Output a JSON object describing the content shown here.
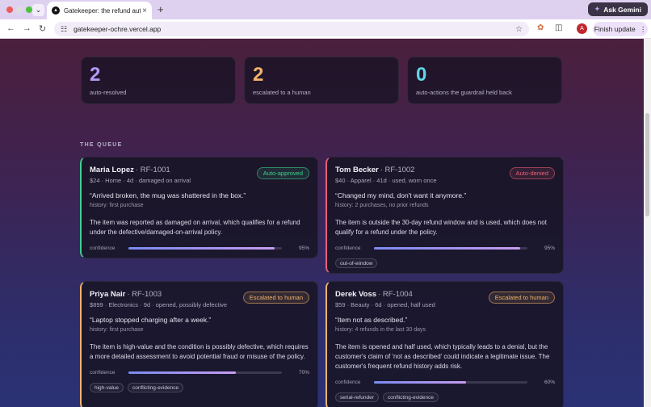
{
  "browser": {
    "tab_title": "Gatekeeper: the refund autopilot",
    "url": "gatekeeper-ochre.vercel.app",
    "gemini_label": "Ask Gemini",
    "update_label": "Finish update",
    "avatar_letter": "A"
  },
  "stats": [
    {
      "value": "2",
      "label": "auto-resolved",
      "color": "#b39cf5"
    },
    {
      "value": "2",
      "label": "escalated to a human",
      "color": "#f2b36b"
    },
    {
      "value": "0",
      "label": "auto-actions the guardrail held back",
      "color": "#5fd7e8"
    }
  ],
  "queue_title": "THE QUEUE",
  "cards": [
    {
      "name": "Maria Lopez",
      "id": "· RF-1001",
      "badge": "Auto-approved",
      "meta": "$24 · Home · 4d · damaged on arrival",
      "quote": "“Arrived broken, the mug was shattered in the box.”",
      "history": "history: first purchase",
      "reason": "The item was reported as damaged on arrival, which qualifies for a refund under the defective/damaged-on-arrival policy.",
      "confidence_label": "confidence",
      "confidence": 95,
      "confidence_text": "95%",
      "tags": [],
      "accent": "#3fd08f"
    },
    {
      "name": "Tom Becker",
      "id": "· RF-1002",
      "badge": "Auto-denied",
      "meta": "$40 · Apparel · 41d · used, worn once",
      "quote": "“Changed my mind, don't want it anymore.”",
      "history": "history: 2 purchases, no prior refunds",
      "reason": "The item is outside the 30-day refund window and is used, which does not qualify for a refund under the policy.",
      "confidence_label": "confidence",
      "confidence": 95,
      "confidence_text": "95%",
      "tags": [
        "out-of-window"
      ],
      "accent": "#e8607a"
    },
    {
      "name": "Priya Nair",
      "id": "· RF-1003",
      "badge": "Escalated to human",
      "meta": "$899 · Electronics · 9d · opened, possibly defective",
      "quote": "“Laptop stopped charging after a week.”",
      "history": "history: first purchase",
      "reason": "The item is high-value and the condition is possibly defective, which requires a more detailed assessment to avoid potential fraud or misuse of the policy.",
      "confidence_label": "confidence",
      "confidence": 70,
      "confidence_text": "70%",
      "tags": [
        "high-value",
        "conflicting-evidence"
      ],
      "accent": "#f2b36b"
    },
    {
      "name": "Derek Voss",
      "id": "· RF-1004",
      "badge": "Escalated to human",
      "meta": "$59 · Beauty · 6d · opened, half used",
      "quote": "“Item not as described.”",
      "history": "history: 4 refunds in the last 30 days",
      "reason": "The item is opened and half used, which typically leads to a denial, but the customer's claim of 'not as described' could indicate a legitimate issue. The customer's frequent refund history adds risk.",
      "confidence_label": "confidence",
      "confidence": 60,
      "confidence_text": "60%",
      "tags": [
        "serial-refunder",
        "conflicting-evidence"
      ],
      "accent": "#f2b36b"
    }
  ]
}
